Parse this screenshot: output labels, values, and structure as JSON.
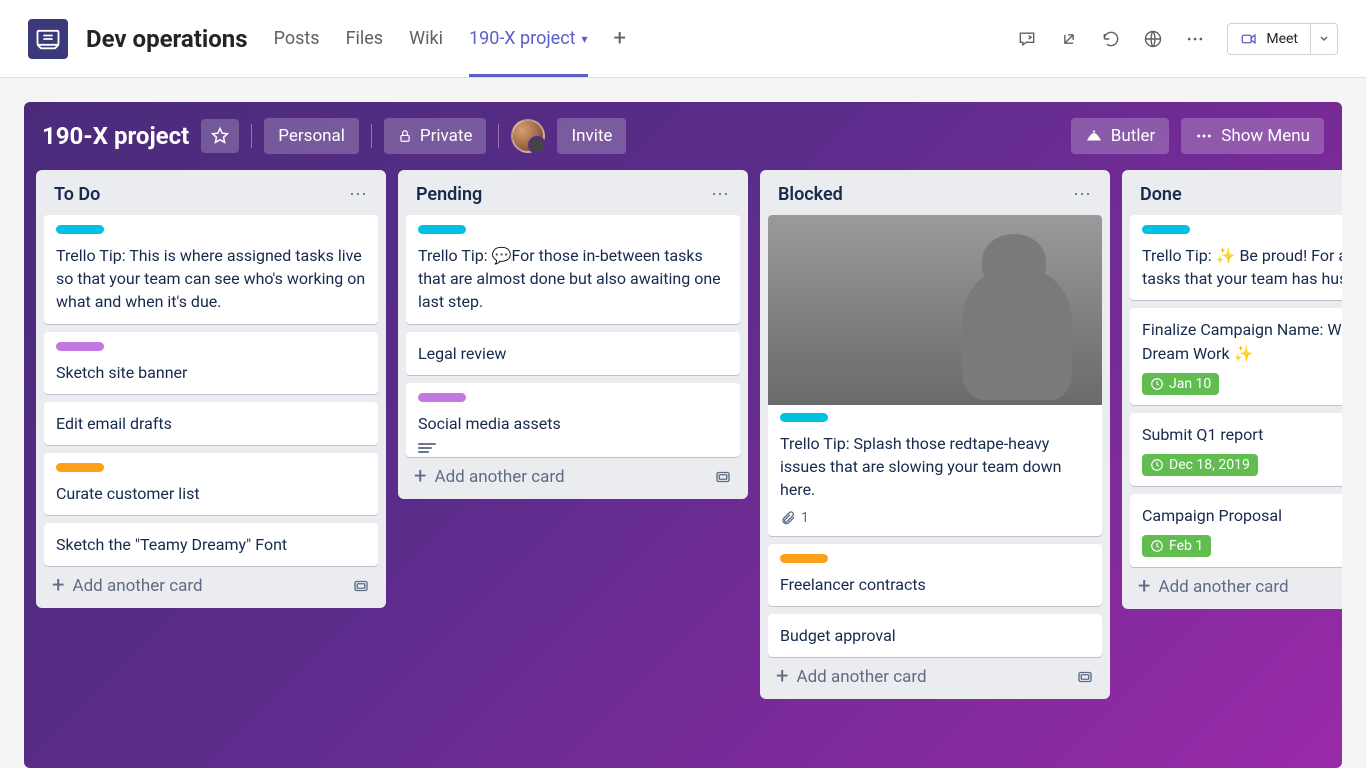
{
  "topbar": {
    "team_name": "Dev operations",
    "tabs": [
      "Posts",
      "Files",
      "Wiki",
      "190-X project"
    ],
    "active_tab": 3,
    "meet_label": "Meet"
  },
  "board": {
    "title": "190-X project",
    "personal_btn": "Personal",
    "private_btn": "Private",
    "invite_btn": "Invite",
    "butler_btn": "Butler",
    "menu_btn": "Show Menu"
  },
  "lists": [
    {
      "title": "To Do",
      "cards": [
        {
          "labels": [
            "teal"
          ],
          "text": "Trello Tip: This is where assigned tasks live so that your team can see who's working on what and when it's due."
        },
        {
          "labels": [
            "purple"
          ],
          "text": "Sketch site banner"
        },
        {
          "text": "Edit email drafts"
        },
        {
          "labels": [
            "orange"
          ],
          "text": "Curate customer list"
        },
        {
          "text": "Sketch the \"Teamy Dreamy\" Font"
        }
      ],
      "add": "Add another card"
    },
    {
      "title": "Pending",
      "cards": [
        {
          "labels": [
            "teal"
          ],
          "text": "Trello Tip: 💬For those in-between tasks that are almost done but also awaiting one last step."
        },
        {
          "text": "Legal review"
        },
        {
          "labels": [
            "purple"
          ],
          "text": "Social media assets",
          "has_desc": true
        }
      ],
      "add": "Add another card"
    },
    {
      "title": "Blocked",
      "cards": [
        {
          "cover": true,
          "labels": [
            "teal"
          ],
          "text": "Trello Tip: Splash those redtape-heavy issues that are slowing your team down here.",
          "attachments": "1"
        },
        {
          "labels": [
            "orange"
          ],
          "text": "Freelancer contracts"
        },
        {
          "text": "Budget approval"
        }
      ],
      "add": "Add another card"
    },
    {
      "title": "Done",
      "cards": [
        {
          "sticker": "star",
          "labels": [
            "teal"
          ],
          "text": "Trello Tip: ✨ Be proud! For all your finished tasks that your team has hustled on."
        },
        {
          "text": "Finalize Campaign Name: WeTeamUp Dream Work ✨",
          "due": "Jan 10"
        },
        {
          "text": "Submit Q1 report",
          "due": "Dec 18, 2019"
        },
        {
          "text": "Campaign Proposal",
          "due": "Feb 1"
        }
      ],
      "add": "Add another card"
    }
  ]
}
